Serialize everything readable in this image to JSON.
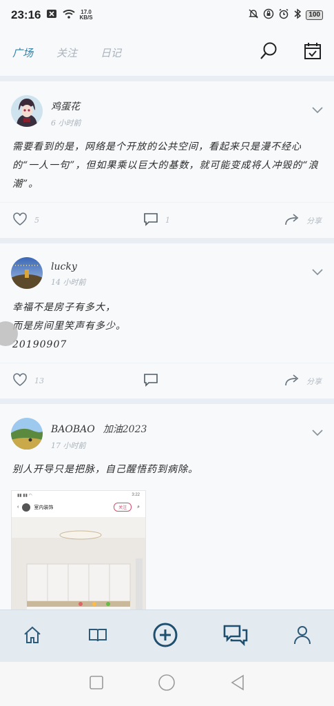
{
  "status_bar": {
    "time": "23:16",
    "speed_value": "17.0",
    "speed_unit": "KB/S",
    "battery": "100"
  },
  "nav": {
    "tabs": [
      {
        "label": "广场"
      },
      {
        "label": "关注"
      },
      {
        "label": "日记"
      }
    ],
    "search_icon": "search-icon",
    "calendar_icon": "calendar-check-icon"
  },
  "posts": [
    {
      "author": "鸡蛋花",
      "badge": "",
      "time": "6 小时前",
      "content": "需要看到的是，网络是个开放的公共空间，看起来只是漫不经心的“一人一句”，但如果乘以巨大的基数，就可能变成将人冲毁的“浪潮”。",
      "likes": "5",
      "comments": "1",
      "share": "分享"
    },
    {
      "author": "lucky",
      "badge": "",
      "time": "14 小时前",
      "content_lines": [
        "幸福不是房子有多大，",
        "而是房间里笑声有多少。",
        "20190907"
      ],
      "likes": "13",
      "comments": "",
      "share": "分享"
    },
    {
      "author": "BAOBAO",
      "badge": "加油2023",
      "time": "17 小时前",
      "content": "别人开导只是把脉，自己醒悟药到病除。",
      "shot": {
        "status_time": "3:22",
        "title": "室内装饰",
        "follow": "关注"
      }
    }
  ],
  "bottom_nav": [
    "home-icon",
    "book-icon",
    "add-circle-icon",
    "messages-icon",
    "profile-icon"
  ],
  "system_nav": [
    "recent-apps-icon",
    "home-circle-icon",
    "back-icon"
  ],
  "colors": {
    "accent": "#2f7fa6",
    "nav_icon": "#2c5a78"
  }
}
